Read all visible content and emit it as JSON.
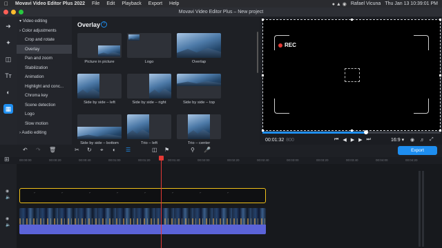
{
  "menubar": {
    "app": "Movavi Video Editor Plus 2022",
    "items": [
      "File",
      "Edit",
      "Playback",
      "Export",
      "Help"
    ],
    "user": "Rafael Vicuna",
    "datetime": "Thu Jan 13  10:39:01 PM"
  },
  "window": {
    "title": "Movavi Video Editor Plus – New project"
  },
  "sidebar_categories": [
    {
      "label": "Video editing",
      "type": "header"
    },
    {
      "label": "Color adjustments",
      "type": "header"
    },
    {
      "label": "Crop and rotate",
      "type": "item"
    },
    {
      "label": "Overlay",
      "type": "item",
      "selected": true
    },
    {
      "label": "Pan and zoom",
      "type": "item"
    },
    {
      "label": "Stabilization",
      "type": "item"
    },
    {
      "label": "Animation",
      "type": "item"
    },
    {
      "label": "Highlight and conc...",
      "type": "item"
    },
    {
      "label": "Chroma key",
      "type": "item"
    },
    {
      "label": "Scene detection",
      "type": "item"
    },
    {
      "label": "Logo",
      "type": "item"
    },
    {
      "label": "Slow motion",
      "type": "item"
    },
    {
      "label": "Audio editing",
      "type": "header"
    }
  ],
  "panel": {
    "title": "Overlay",
    "help_icon": "?",
    "tiles": [
      {
        "label": "Picture in picture"
      },
      {
        "label": "Logo"
      },
      {
        "label": "Overlap"
      },
      {
        "label": "Side by side – left"
      },
      {
        "label": "Side by side – right"
      },
      {
        "label": "Side by side – top"
      },
      {
        "label": "Side by side – bottom"
      },
      {
        "label": "Trio – left"
      },
      {
        "label": "Trio – center"
      }
    ]
  },
  "preview": {
    "rec_label": "REC"
  },
  "transport": {
    "timecode": "00:01:32",
    "timecode_frames": "800",
    "aspect_ratio": "16:9",
    "progress": 0.58
  },
  "toolbar": {
    "export_label": "Export"
  },
  "ruler": {
    "ticks": [
      "00:00:00",
      "00:00:20",
      "00:00:40",
      "00:01:00",
      "00:01:20",
      "00:01:40",
      "00:02:00",
      "00:02:20",
      "00:02:40",
      "00:03:00",
      "00:03:20",
      "00:03:40",
      "00:04:00",
      "00:04:20"
    ]
  },
  "colors": {
    "accent": "#1e8ef0",
    "playhead": "#e53935",
    "selected_clip_border": "#f2c21b",
    "audio_track": "#5b63d8"
  }
}
